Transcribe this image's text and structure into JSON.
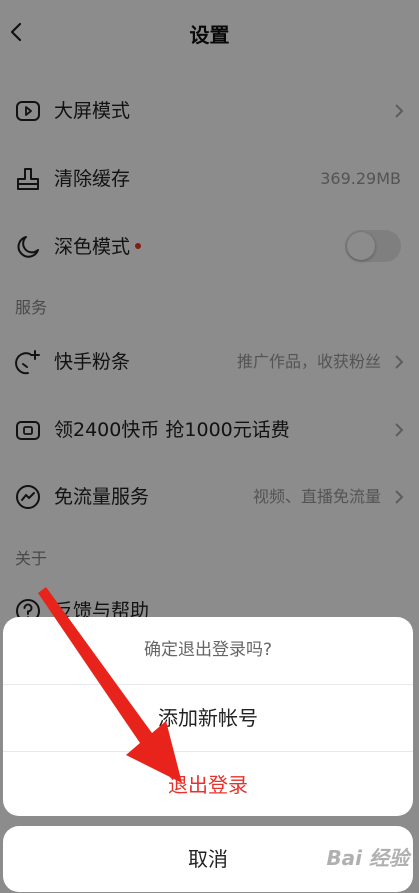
{
  "header": {
    "title": "设置"
  },
  "rows": {
    "big_screen": {
      "label": "大屏模式"
    },
    "clear_cache": {
      "label": "清除缓存",
      "value": "369.29MB"
    },
    "dark_mode": {
      "label": "深色模式",
      "enabled": false
    }
  },
  "sections": {
    "services": {
      "title": "服务",
      "items": [
        {
          "label": "快手粉条",
          "value": "推广作品，收获粉丝"
        },
        {
          "label": "领2400快币 抢1000元话费"
        },
        {
          "label": "免流量服务",
          "value": "视频、直播免流量"
        }
      ]
    },
    "about": {
      "title": "关于",
      "items": [
        {
          "label": "反馈与帮助"
        }
      ]
    }
  },
  "dialog": {
    "question": "确定退出登录吗?",
    "add_account": "添加新帐号",
    "logout": "退出登录",
    "cancel": "取消"
  },
  "watermark": {
    "text": "Bai 经验"
  },
  "colors": {
    "danger": "#e8322c",
    "annotation_arrow": "#e8231c",
    "overlay": "rgba(0,0,0,0.45)"
  },
  "icons": [
    "back-arrow",
    "play-screen",
    "broom",
    "moon",
    "leaf-plus",
    "coin-card",
    "trend-circle",
    "question-circle",
    "chevron-right"
  ]
}
